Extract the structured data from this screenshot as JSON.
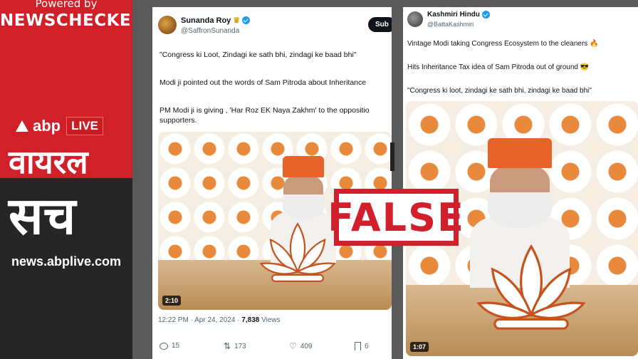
{
  "branding": {
    "powered_by": "Powered by",
    "checker": "NEWSCHECKER",
    "abp": "abp",
    "live": "LIVE",
    "hindi_title_1": "वायरल",
    "hindi_title_2": "सच",
    "website": "news.abplive.com"
  },
  "tweet_left": {
    "name": "Sunanda Roy",
    "handle": "@SaffronSunanda",
    "subscribe_label": "Sub",
    "line_1": "\"Congress ki Loot, Zindagi ke sath bhi, zindagi ke baad bhi\"",
    "line_2": "Modi ji pointed out the words of Sam Pitroda about Inheritance",
    "line_3": "PM Modi ji is giving , 'Har Roz EK Naya Zakhm' to the oppositio",
    "line_4": "supporters.",
    "video_duration": "2:10",
    "timestamp": "12:22 PM · Apr 24, 2024 · ",
    "views_count": "7,838",
    "views_label": " Views",
    "replies": "15",
    "reposts": "173",
    "likes": "409",
    "bookmarks": "6"
  },
  "tweet_right": {
    "name": "Kashmiri Hindu",
    "handle": "@BattaKashmiri",
    "line_1": "Vintage Modi taking Congress Ecosystem to the cleaners 🔥",
    "line_2": "Hits Inheritance Tax idea of Sam Pitroda out of ground 😎",
    "line_3": "\"Congress ki loot, zindagi ke sath bhi, zindagi ke baad bhi\"",
    "video_duration": "1:07"
  },
  "stamp": {
    "text": "FALSE"
  },
  "icons": [
    "crown-icon",
    "verified-icon",
    "reply-icon",
    "repost-icon",
    "like-icon",
    "bookmark-icon",
    "play-duration-badge"
  ],
  "colors": {
    "brand_red": "#d0212a",
    "panel_dark": "#262626",
    "verified_blue": "#1d9bf0",
    "stamp_red": "#d21f2b",
    "saffron": "#e9893c"
  }
}
